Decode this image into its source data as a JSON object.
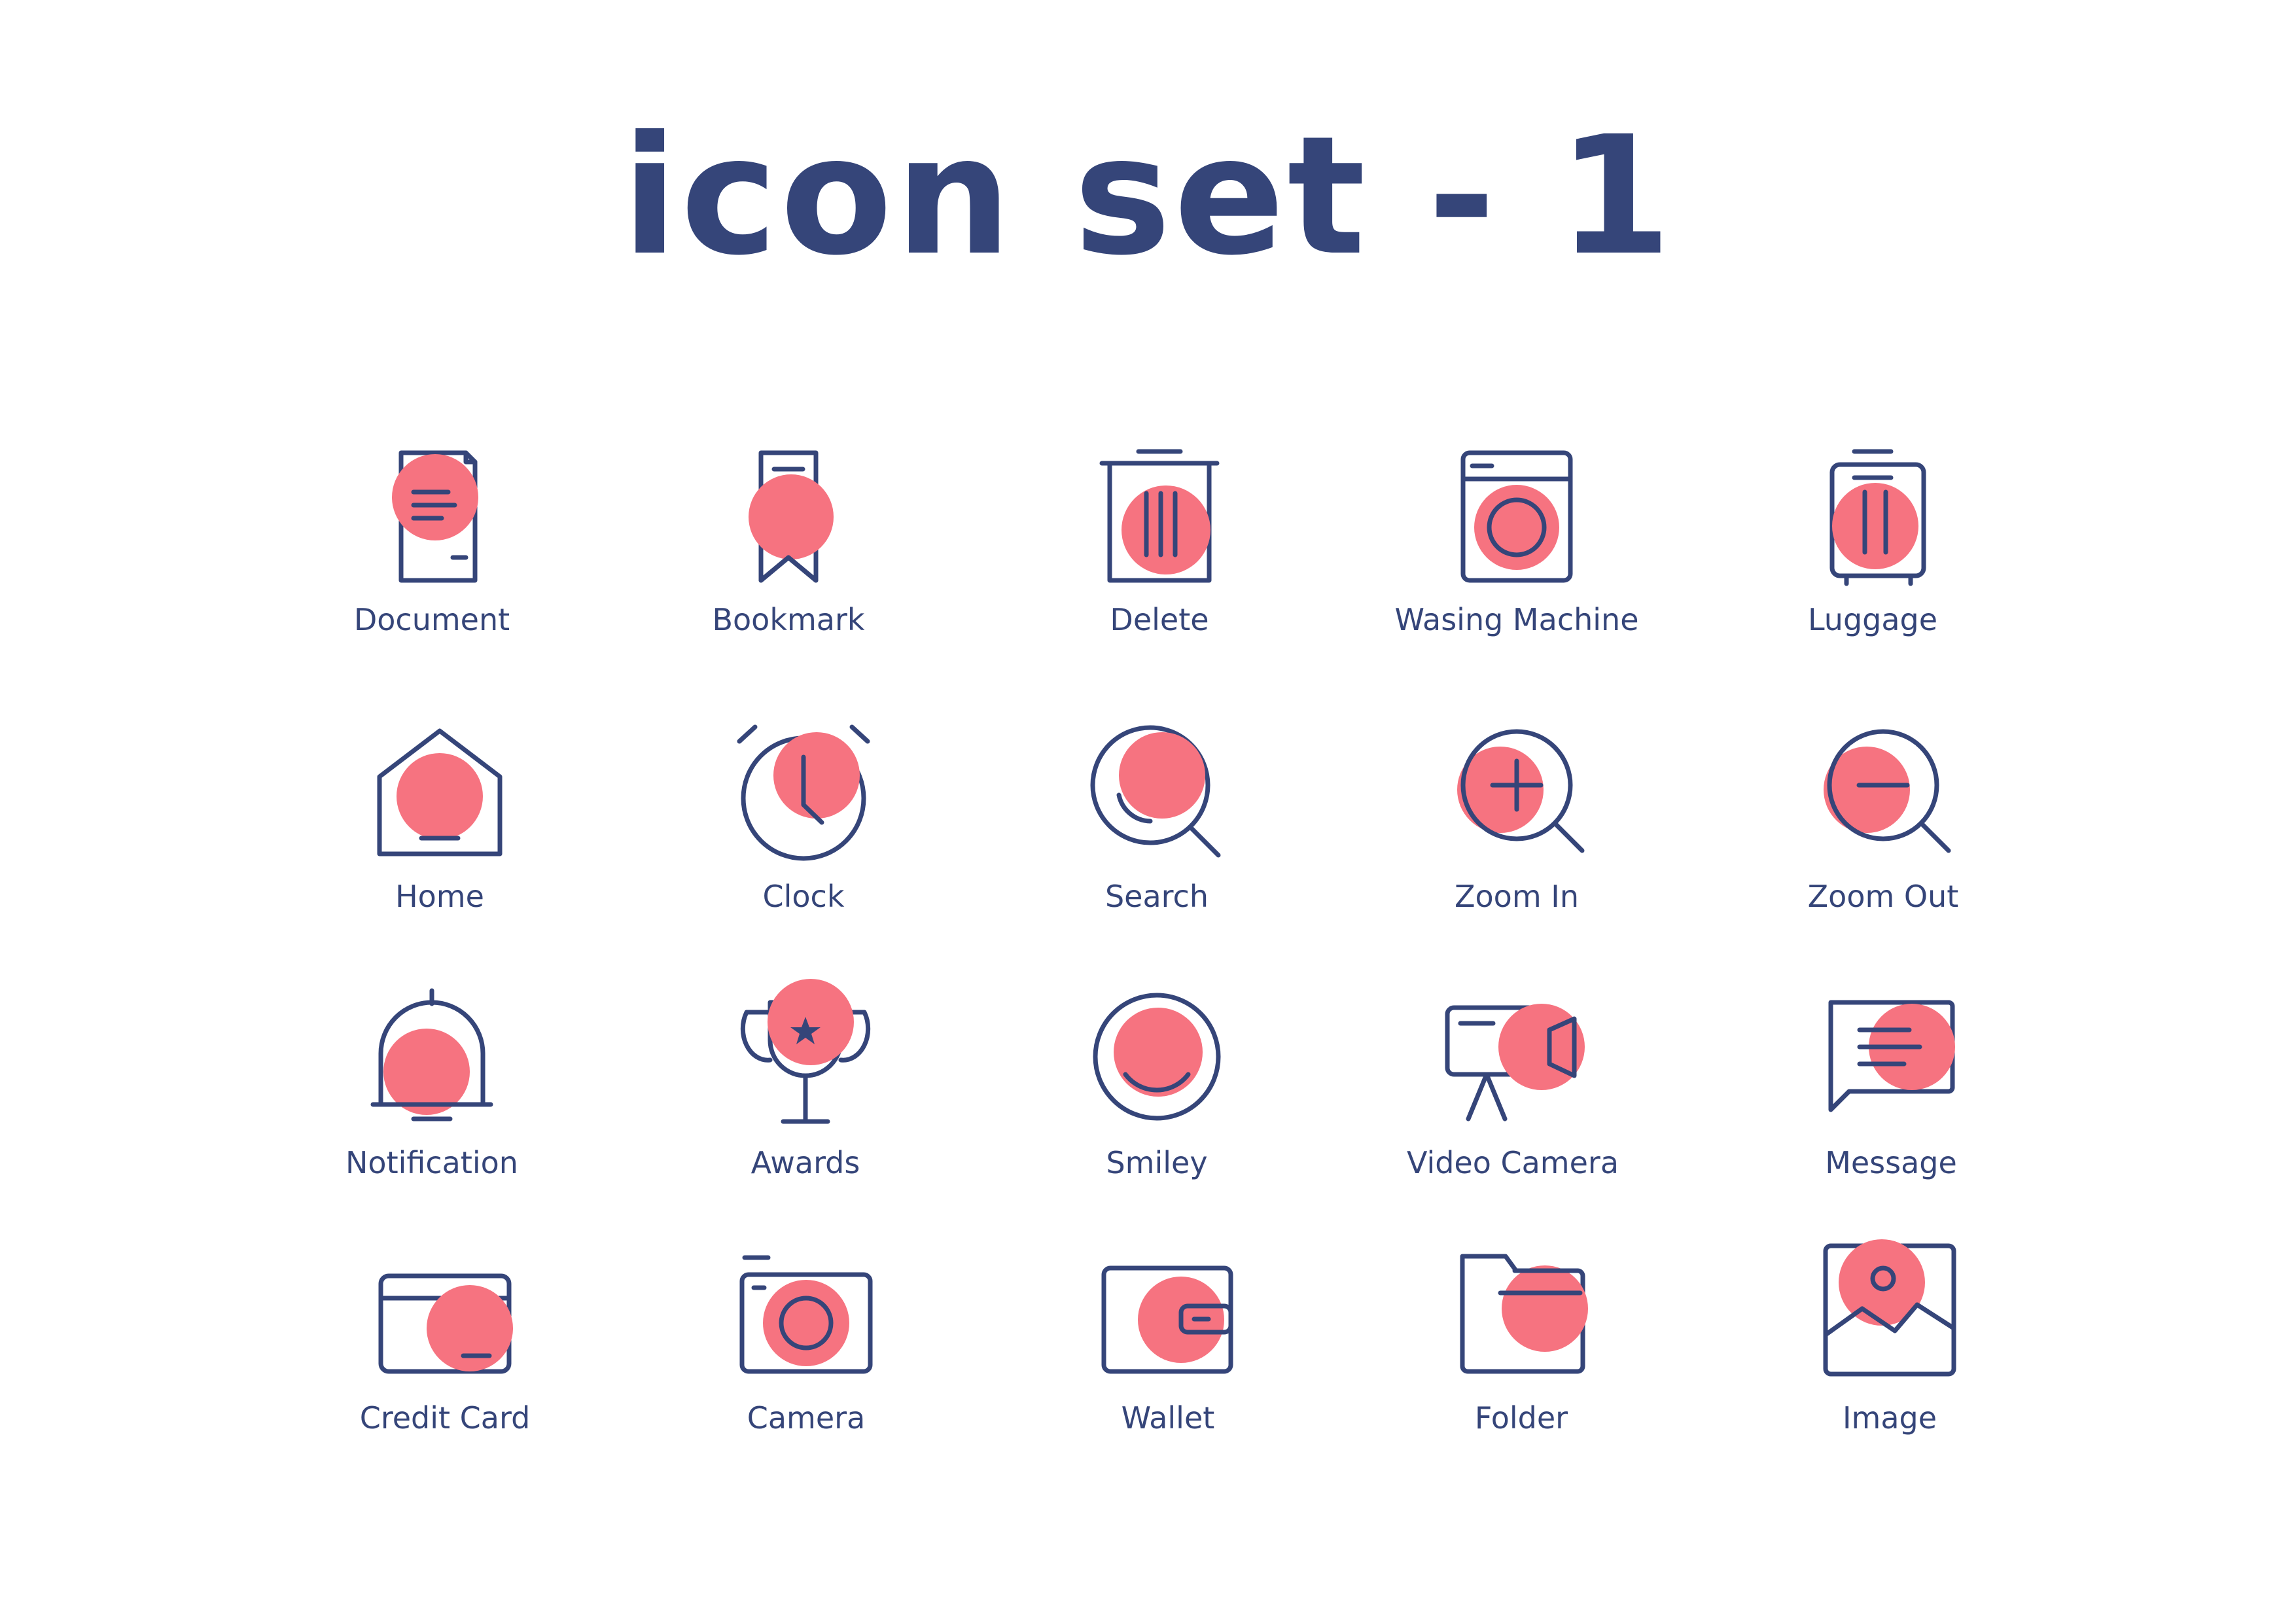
{
  "title": "icon set - 1",
  "colors": {
    "stroke": "#354579",
    "accent": "#F67380",
    "background": "#FFFFFF"
  },
  "icons": [
    {
      "icon": "document-icon",
      "label": "Document"
    },
    {
      "icon": "bookmark-icon",
      "label": "Bookmark"
    },
    {
      "icon": "delete-icon",
      "label": "Delete"
    },
    {
      "icon": "washing-machine-icon",
      "label": "Wasing Machine"
    },
    {
      "icon": "luggage-icon",
      "label": "Luggage"
    },
    {
      "icon": "home-icon",
      "label": "Home"
    },
    {
      "icon": "clock-icon",
      "label": "Clock"
    },
    {
      "icon": "search-icon",
      "label": "Search"
    },
    {
      "icon": "zoom-in-icon",
      "label": "Zoom In"
    },
    {
      "icon": "zoom-out-icon",
      "label": "Zoom Out"
    },
    {
      "icon": "notification-icon",
      "label": "Notification"
    },
    {
      "icon": "awards-icon",
      "label": "Awards"
    },
    {
      "icon": "smiley-icon",
      "label": "Smiley"
    },
    {
      "icon": "video-camera-icon",
      "label": "Video Camera"
    },
    {
      "icon": "message-icon",
      "label": "Message"
    },
    {
      "icon": "credit-card-icon",
      "label": "Credit Card"
    },
    {
      "icon": "camera-icon",
      "label": "Camera"
    },
    {
      "icon": "wallet-icon",
      "label": "Wallet"
    },
    {
      "icon": "folder-icon",
      "label": "Folder"
    },
    {
      "icon": "image-icon",
      "label": "Image"
    }
  ]
}
